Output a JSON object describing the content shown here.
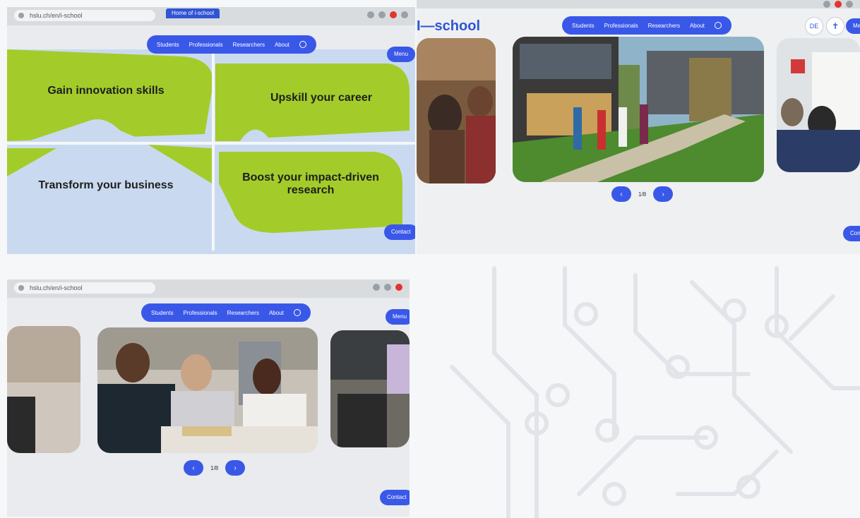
{
  "browser": {
    "url": "hslu.ch/en/i-school",
    "tab_label": "Home of i-school"
  },
  "nav": {
    "items": [
      "Students",
      "Professionals",
      "Researchers",
      "About"
    ]
  },
  "header": {
    "logo": "I—school",
    "menu_label": "Menu",
    "lang_label": "DE"
  },
  "tiles": {
    "t1": "Gain innovation skills",
    "t2": "Upskill your career",
    "t3": "Transform your business",
    "t4": "Boost your impact-driven research"
  },
  "carousel": {
    "counter": "1/8",
    "prev_icon": "chevron-left-icon",
    "next_icon": "chevron-right-icon"
  },
  "contact_label": "Contact",
  "colors": {
    "accent": "#3a58e8",
    "tile_green": "#a3cc2a",
    "tile_blue": "#c9daf0"
  }
}
